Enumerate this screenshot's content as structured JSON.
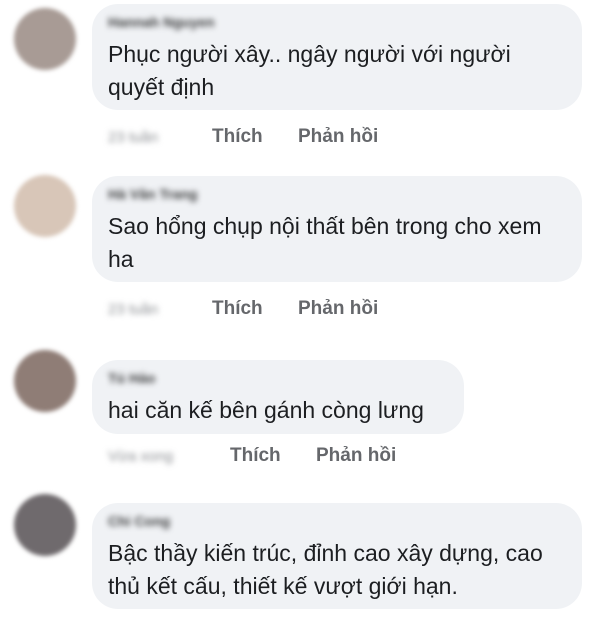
{
  "comments": [
    {
      "author": "Hannah Nguyen",
      "text": "Phục người xây.. ngây người với người quyết định",
      "time": "23 tuần",
      "avatar_color": "#a89b95"
    },
    {
      "author": "Hà Vân Trang",
      "text": "Sao hổng chụp nội thất bên trong cho xem ha",
      "time": "23 tuần",
      "avatar_color": "#d8c6b8"
    },
    {
      "author": "Tú Hảo",
      "text": "hai căn kế bên gánh còng lưng",
      "time": "Vừa xong",
      "avatar_color": "#8f7d76"
    },
    {
      "author": "Chi Cong",
      "text": "Bậc thầy kiến trúc, đỉnh cao xây dựng, cao thủ kết cấu, thiết kế vượt giới hạn.",
      "time": "",
      "avatar_color": "#6f6a6d"
    }
  ],
  "actions": {
    "like_label": "Thích",
    "reply_label": "Phản hồi"
  }
}
